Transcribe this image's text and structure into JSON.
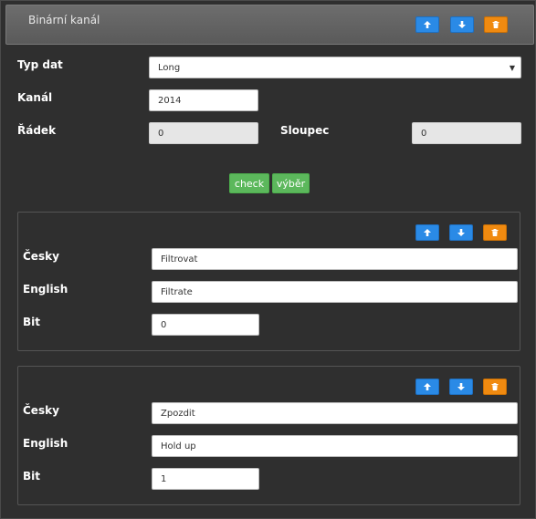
{
  "panel": {
    "title": "Binární kanál",
    "icons": {
      "up": "arrow-up-icon",
      "down": "arrow-down-icon",
      "delete": "trash-icon"
    },
    "colors": {
      "blue": "#2a8ae6",
      "orange": "#f08a10",
      "green": "#5cb85c"
    }
  },
  "form": {
    "typ_dat_label": "Typ dat",
    "typ_dat_value": "Long",
    "kanal_label": "Kanál",
    "kanal_value": "2014",
    "radek_label": "Řádek",
    "radek_value": "0",
    "sloupec_label": "Sloupec",
    "sloupec_value": "0",
    "check_label": "check",
    "vyber_label": "výběr"
  },
  "items": [
    {
      "cesky_label": "Česky",
      "cesky_value": "Filtrovat",
      "english_label": "English",
      "english_value": "Filtrate",
      "bit_label": "Bit",
      "bit_value": "0"
    },
    {
      "cesky_label": "Česky",
      "cesky_value": "Zpozdit",
      "english_label": "English",
      "english_value": "Hold up",
      "bit_label": "Bit",
      "bit_value": "1"
    }
  ]
}
